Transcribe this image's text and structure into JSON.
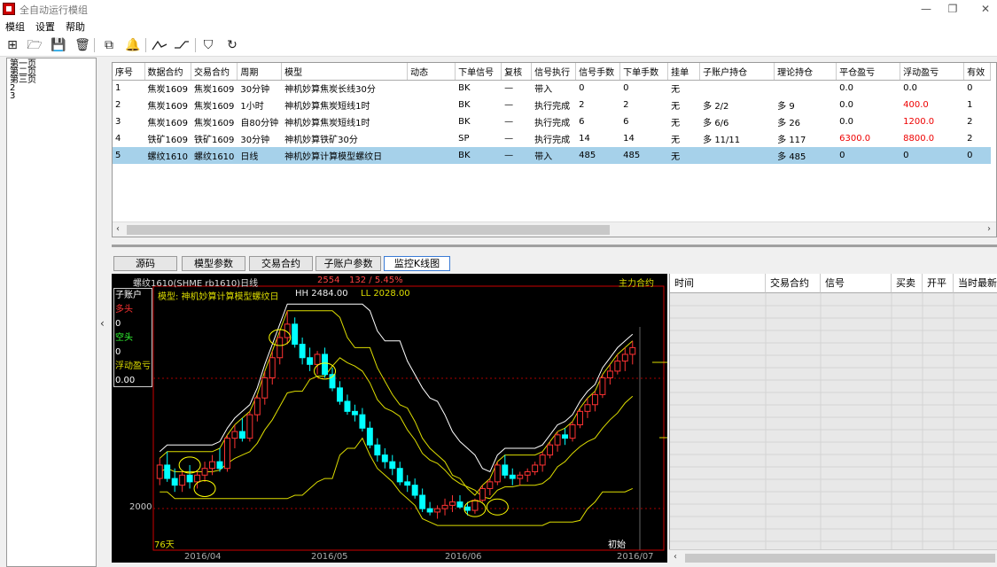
{
  "window": {
    "title": "全自动运行模组",
    "minimize": "—",
    "maximize": "❐",
    "close": "✕"
  },
  "menu": [
    "模组",
    "设置",
    "帮助"
  ],
  "toolbar": {
    "icons": [
      "new-icon",
      "open-icon",
      "save-icon",
      "delete-icon",
      "export-icon",
      "bell-icon",
      "trend-up-icon",
      "trend-down-icon",
      "shield-icon",
      "refresh-icon"
    ],
    "glyphs": [
      "⊞",
      "🗁",
      "💾",
      "🗑",
      "⧉",
      "🔔",
      "⁄",
      "⁄",
      "⛉",
      "↻"
    ]
  },
  "left_panel": {
    "pages": [
      "第一页",
      "第二页",
      "第三页",
      "2",
      "3"
    ],
    "collapse": "‹"
  },
  "table": {
    "headers": [
      "序号",
      "数据合约",
      "交易合约",
      "周期",
      "模型",
      "动态",
      "下单信号",
      "复核",
      "信号执行",
      "信号手数",
      "下单手数",
      "挂单",
      "子账户持仓",
      "理论持仓",
      "平仓盈亏",
      "浮动盈亏",
      "有效"
    ],
    "rows": [
      [
        "1",
        "焦炭1609",
        "焦炭1609",
        "30分钟",
        "神机妙算焦炭长线30分",
        "",
        "BK",
        "—",
        "带入",
        "0",
        "0",
        "无",
        "",
        "",
        "0.0",
        "0.0",
        "0"
      ],
      [
        "2",
        "焦炭1609",
        "焦炭1609",
        "1小时",
        "神机妙算焦炭短线1时",
        "",
        "BK",
        "—",
        "执行完成",
        "2",
        "2",
        "无",
        "多 2/2",
        "多 9",
        "0.0",
        "400.0",
        "1"
      ],
      [
        "3",
        "焦炭1609",
        "焦炭1609",
        "自80分钟",
        "神机妙算焦炭短线1时",
        "",
        "BK",
        "—",
        "执行完成",
        "6",
        "6",
        "无",
        "多 6/6",
        "多 26",
        "0.0",
        "1200.0",
        "2"
      ],
      [
        "4",
        "铁矿1609",
        "铁矿1609",
        "30分钟",
        "神机妙算铁矿30分",
        "",
        "SP",
        "—",
        "执行完成",
        "14",
        "14",
        "无",
        "多 11/11",
        "多 117",
        "6300.0",
        "8800.0",
        "2"
      ],
      [
        "5",
        "螺纹1610",
        "螺纹1610",
        "日线",
        "神机妙算计算模型螺纹日",
        "",
        "BK",
        "—",
        "带入",
        "485",
        "485",
        "无",
        "",
        "多 485",
        "0",
        "0",
        "0"
      ]
    ],
    "selected_row": 4,
    "red_cells": [
      [
        1,
        15
      ],
      [
        2,
        15
      ],
      [
        3,
        14
      ],
      [
        3,
        15
      ]
    ]
  },
  "tabs": [
    "源码",
    "模型参数",
    "交易合约",
    "子账户参数",
    "监控K线图"
  ],
  "active_tab": 4,
  "chart": {
    "header_left": "螺纹1610(SHME rb1610)日线",
    "header_price": "2554",
    "header_change": "132 / 5.45%",
    "header_right": "主力合约",
    "model_line": "模型: 神机妙算计算模型螺纹日",
    "hh": "HH 2484.00",
    "ll": "LL 2028.00",
    "legend": {
      "title": "子账户",
      "long_label": "多头",
      "long_value": "0",
      "short_label": "空头",
      "short_value": "0",
      "float_label": "浮动盈亏",
      "float_value": "0.00"
    },
    "price_label": "2000",
    "days_label": "76天",
    "start_label": "初始",
    "date_labels": [
      "2016/04",
      "2016/05",
      "2016/06",
      "2016/07"
    ],
    "colors": {
      "up": "#ff3333",
      "down": "#00ffff",
      "white_line": "#ffffff",
      "yellow_line": "#dddd00",
      "circle": "#ffff00"
    }
  },
  "chart_data": {
    "type": "candlestick",
    "x_labels": [
      "2016/04",
      "2016/05",
      "2016/06",
      "2016/07"
    ],
    "y_tick": 2000,
    "ohlc": [
      [
        2080,
        2140,
        2060,
        2120
      ],
      [
        2120,
        2160,
        2070,
        2080
      ],
      [
        2080,
        2110,
        2040,
        2060
      ],
      [
        2060,
        2100,
        2040,
        2090
      ],
      [
        2090,
        2120,
        2050,
        2070
      ],
      [
        2070,
        2100,
        2050,
        2090
      ],
      [
        2090,
        2130,
        2070,
        2110
      ],
      [
        2110,
        2150,
        2090,
        2130
      ],
      [
        2130,
        2170,
        2100,
        2110
      ],
      [
        2110,
        2210,
        2100,
        2200
      ],
      [
        2200,
        2240,
        2170,
        2220
      ],
      [
        2220,
        2260,
        2190,
        2200
      ],
      [
        2200,
        2280,
        2190,
        2270
      ],
      [
        2270,
        2330,
        2250,
        2320
      ],
      [
        2320,
        2400,
        2300,
        2380
      ],
      [
        2380,
        2460,
        2360,
        2440
      ],
      [
        2440,
        2520,
        2420,
        2500
      ],
      [
        2500,
        2580,
        2480,
        2540
      ],
      [
        2540,
        2560,
        2470,
        2480
      ],
      [
        2480,
        2500,
        2420,
        2440
      ],
      [
        2440,
        2470,
        2400,
        2420
      ],
      [
        2420,
        2460,
        2390,
        2450
      ],
      [
        2450,
        2470,
        2380,
        2390
      ],
      [
        2390,
        2410,
        2340,
        2350
      ],
      [
        2350,
        2370,
        2300,
        2310
      ],
      [
        2310,
        2330,
        2270,
        2280
      ],
      [
        2280,
        2300,
        2250,
        2270
      ],
      [
        2270,
        2290,
        2220,
        2230
      ],
      [
        2230,
        2250,
        2170,
        2180
      ],
      [
        2180,
        2200,
        2130,
        2150
      ],
      [
        2150,
        2170,
        2110,
        2130
      ],
      [
        2130,
        2150,
        2090,
        2110
      ],
      [
        2110,
        2130,
        2060,
        2070
      ],
      [
        2070,
        2090,
        2040,
        2060
      ],
      [
        2060,
        2080,
        2020,
        2030
      ],
      [
        2030,
        2050,
        1980,
        1990
      ],
      [
        1990,
        2010,
        1970,
        1980
      ],
      [
        1980,
        2000,
        1960,
        1990
      ],
      [
        1990,
        2020,
        1970,
        2000
      ],
      [
        2000,
        2030,
        1980,
        2010
      ],
      [
        2010,
        2030,
        1990,
        1995
      ],
      [
        1995,
        2010,
        1970,
        1985
      ],
      [
        1985,
        2020,
        1975,
        2015
      ],
      [
        2015,
        2060,
        2010,
        2050
      ],
      [
        2050,
        2080,
        2030,
        2070
      ],
      [
        2070,
        2130,
        2060,
        2120
      ],
      [
        2120,
        2150,
        2080,
        2090
      ],
      [
        2090,
        2110,
        2060,
        2080
      ],
      [
        2080,
        2100,
        2060,
        2090
      ],
      [
        2090,
        2110,
        2070,
        2100
      ],
      [
        2100,
        2130,
        2090,
        2120
      ],
      [
        2120,
        2160,
        2100,
        2150
      ],
      [
        2150,
        2190,
        2140,
        2180
      ],
      [
        2180,
        2220,
        2160,
        2210
      ],
      [
        2210,
        2230,
        2180,
        2200
      ],
      [
        2200,
        2250,
        2190,
        2240
      ],
      [
        2240,
        2290,
        2230,
        2280
      ],
      [
        2280,
        2320,
        2260,
        2300
      ],
      [
        2300,
        2340,
        2280,
        2330
      ],
      [
        2330,
        2390,
        2320,
        2380
      ],
      [
        2380,
        2420,
        2360,
        2400
      ],
      [
        2400,
        2450,
        2390,
        2430
      ],
      [
        2430,
        2470,
        2400,
        2450
      ],
      [
        2450,
        2490,
        2420,
        2470
      ]
    ]
  },
  "right_list": {
    "headers": [
      "时间",
      "交易合约",
      "信号",
      "买卖",
      "开平",
      "当时最新"
    ]
  }
}
